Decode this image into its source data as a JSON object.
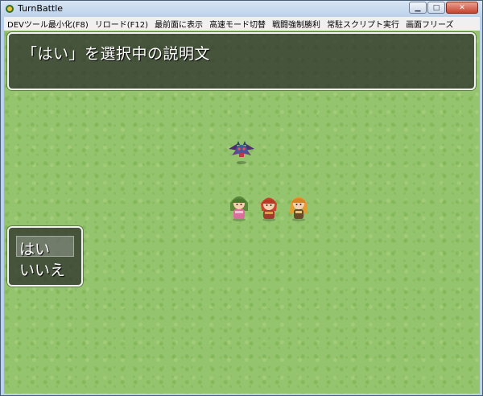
{
  "window": {
    "title": "TurnBattle"
  },
  "menu": {
    "items": [
      "DEVツール最小化(F8)",
      "リロード(F12)",
      "最前面に表示",
      "高速モード切替",
      "戦闘強制勝利",
      "常駐スクリプト実行",
      "画面フリーズ"
    ]
  },
  "battle": {
    "help_text": "「はい」を選択中の説明文",
    "choices": [
      "はい",
      "いいえ"
    ],
    "selected_choice": "はい",
    "enemy": {
      "icon": "winged-demon-enemy-icon"
    },
    "party": [
      "green-hair-actor-icon",
      "red-hair-actor-icon",
      "orange-hair-actor-icon"
    ]
  },
  "colors": {
    "grass": "#94c46d",
    "window_frame": "#f2f2f2",
    "window_fill": "#3a3a3a"
  }
}
